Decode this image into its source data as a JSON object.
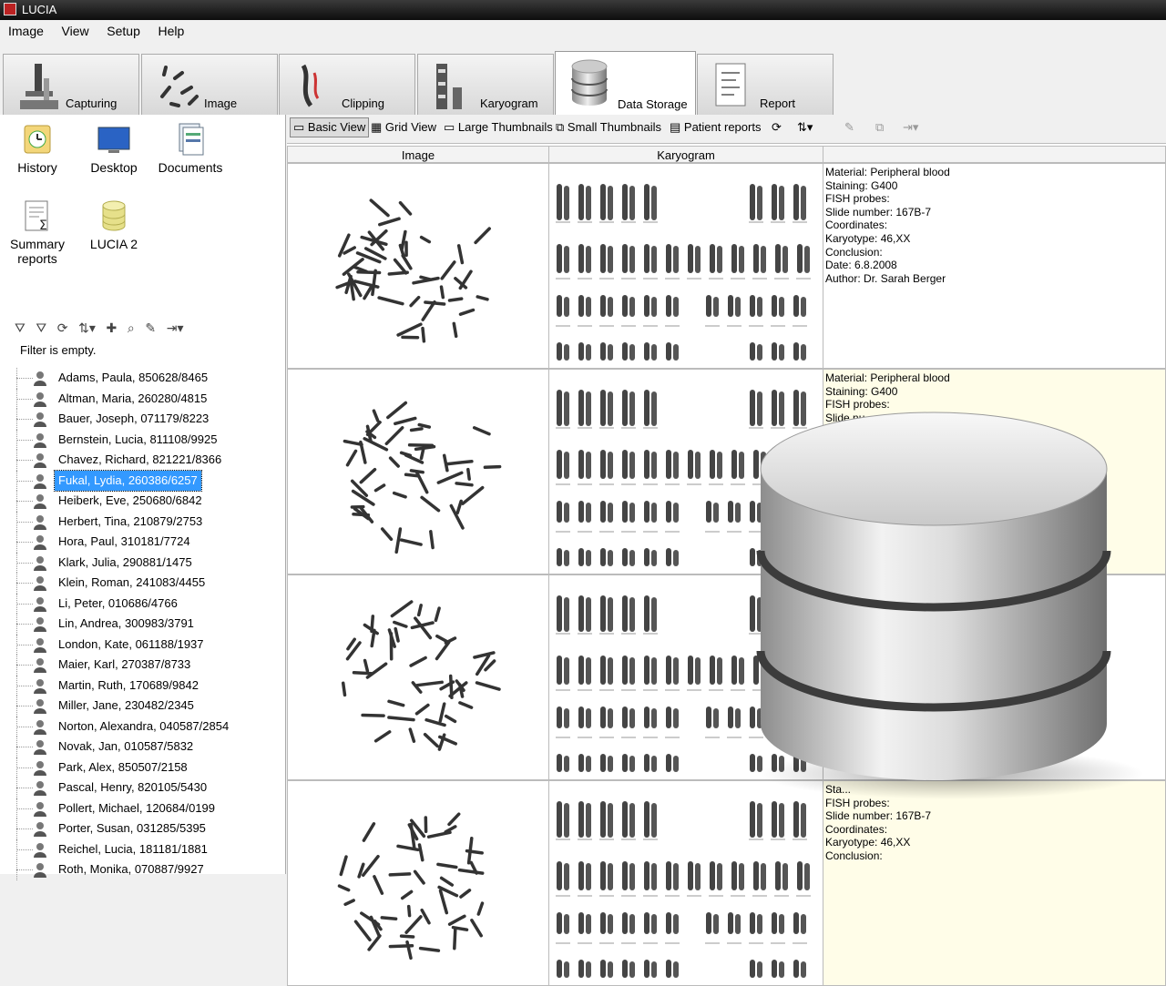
{
  "app": {
    "title": "LUCIA"
  },
  "menu": [
    "Image",
    "View",
    "Setup",
    "Help"
  ],
  "tabs": [
    {
      "label": "Capturing",
      "icon": "microscope-icon"
    },
    {
      "label": "Image",
      "icon": "chromosome-spread-icon"
    },
    {
      "label": "Clipping",
      "icon": "chromosome-clip-icon"
    },
    {
      "label": "Karyogram",
      "icon": "karyogram-icon"
    },
    {
      "label": "Data Storage",
      "icon": "database-icon",
      "active": true
    },
    {
      "label": "Report",
      "icon": "report-icon"
    }
  ],
  "shortcuts": [
    {
      "label": "History",
      "icon": "history-icon"
    },
    {
      "label": "Desktop",
      "icon": "desktop-icon"
    },
    {
      "label": "Documents",
      "icon": "documents-icon"
    },
    {
      "label": "Summary reports",
      "icon": "summary-reports-icon"
    },
    {
      "label": "LUCIA 2",
      "icon": "database-small-icon"
    }
  ],
  "filter": {
    "status": "Filter is empty."
  },
  "patients": [
    "Adams, Paula, 850628/8465",
    "Altman, Maria, 260280/4815",
    "Bauer, Joseph, 071179/8223",
    "Bernstein, Lucia, 811108/9925",
    "Chavez, Richard, 821221/8366",
    "Fukal, Lydia, 260386/6257",
    "Heiberk, Eve, 250680/6842",
    "Herbert, Tina, 210879/2753",
    "Hora, Paul, 310181/7724",
    "Klark, Julia, 290881/1475",
    "Klein, Roman, 241083/4455",
    "Li, Peter, 010686/4766",
    "Lin, Andrea, 300983/3791",
    "London, Kate, 061188/1937",
    "Maier, Karl, 270387/8733",
    "Martin, Ruth, 170689/9842",
    "Miller, Jane, 230482/2345",
    "Norton, Alexandra, 040587/2854",
    "Novak, Jan, 010587/5832",
    "Park, Alex, 850507/2158",
    "Pascal, Henry, 820105/5430",
    "Pollert, Michael, 120684/0199",
    "Porter, Susan, 031285/5395",
    "Reichel, Lucia, 181181/1881",
    "Roth, Monika, 070887/9927"
  ],
  "selected_patient_index": 5,
  "view_toolbar": {
    "basic_view": "Basic View",
    "grid_view": "Grid View",
    "large_thumbnails": "Large Thumbnails",
    "small_thumbnails": "Small Thumbnails",
    "patient_reports": "Patient reports"
  },
  "columns": {
    "image": "Image",
    "karyogram": "Karyogram"
  },
  "records": [
    {
      "lines": [
        "Material: Peripheral blood",
        "Staining: G400",
        "FISH probes:",
        "Slide number: 167B-7",
        "Coordinates:",
        "Karyotype: 46,XX",
        "Conclusion:",
        "Date: 6.8.2008",
        "Author: Dr. Sarah Berger"
      ]
    },
    {
      "lines": [
        "Material: Peripheral blood",
        "Staining: G400",
        "FISH probes:",
        "Slide nu..."
      ]
    },
    {
      "lines": []
    },
    {
      "lines": [
        "Sta...",
        "FISH probes:",
        "Slide number: 167B-7",
        "Coordinates:",
        "Karyotype: 46,XX",
        "Conclusion:"
      ]
    }
  ],
  "colors": {
    "selection": "#3399ff",
    "info_alt_bg": "#fffde8",
    "titlebar": "#1a1a1a"
  }
}
